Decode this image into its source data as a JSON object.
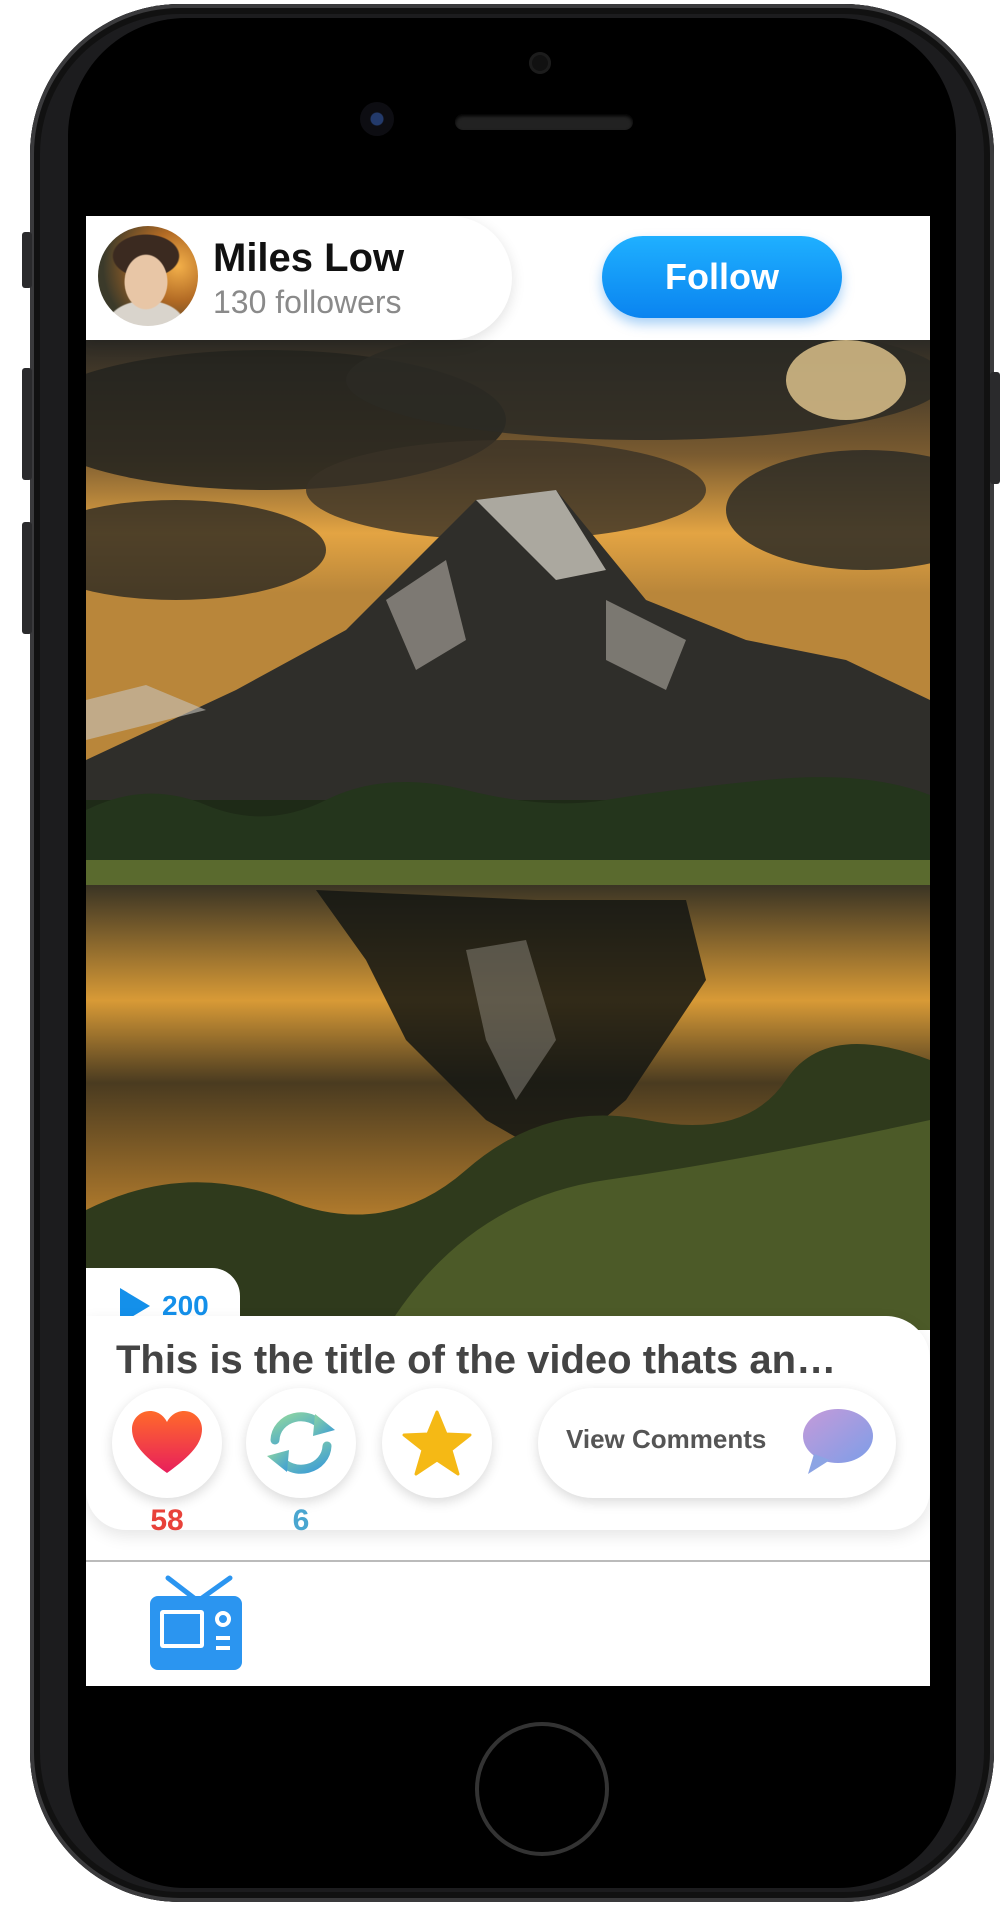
{
  "profile": {
    "name": "Miles Low",
    "followers": "130 followers",
    "follow_label": "Follow"
  },
  "video": {
    "views": "200",
    "title": "This is the title of the video thats an…",
    "likes": "58",
    "reposts": "6",
    "comments_label": "View Comments"
  },
  "icons": {
    "views": "play-icon",
    "like": "heart-icon",
    "repost": "repost-icon",
    "favorite": "star-icon",
    "comments": "speech-bubble-icon",
    "tab_home": "tv-icon"
  },
  "colors": {
    "accent": "#0a84f0",
    "like": "#e8423a",
    "repost": "#4aa6d0",
    "star": "#f5b915"
  }
}
